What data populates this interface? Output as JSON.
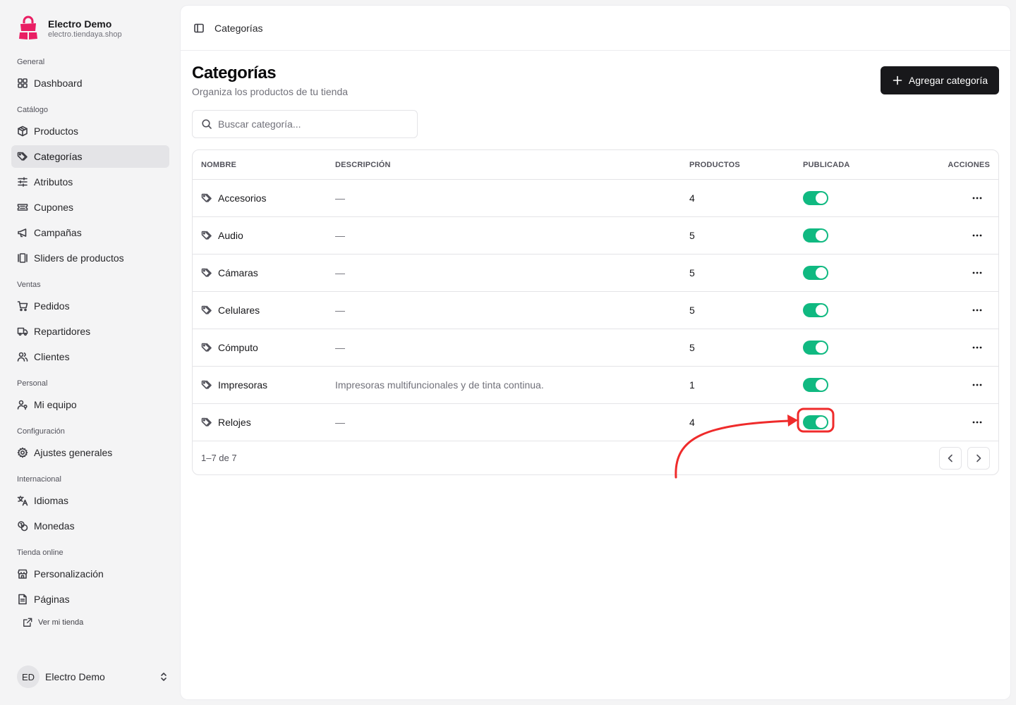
{
  "brand": {
    "name": "Electro Demo",
    "url": "electro.tiendaya.shop",
    "logo_color": "#e91e63"
  },
  "sidebar": {
    "sections": [
      {
        "label": "General",
        "items": [
          {
            "label": "Dashboard",
            "icon": "grid-icon"
          }
        ]
      },
      {
        "label": "Catálogo",
        "items": [
          {
            "label": "Productos",
            "icon": "box-icon"
          },
          {
            "label": "Categorías",
            "icon": "tag-icon",
            "active": true
          },
          {
            "label": "Atributos",
            "icon": "sliders-icon"
          },
          {
            "label": "Cupones",
            "icon": "ticket-icon"
          },
          {
            "label": "Campañas",
            "icon": "megaphone-icon"
          },
          {
            "label": "Sliders de productos",
            "icon": "gallery-icon"
          }
        ]
      },
      {
        "label": "Ventas",
        "items": [
          {
            "label": "Pedidos",
            "icon": "cart-icon"
          },
          {
            "label": "Repartidores",
            "icon": "truck-icon"
          },
          {
            "label": "Clientes",
            "icon": "users-icon"
          }
        ]
      },
      {
        "label": "Personal",
        "items": [
          {
            "label": "Mi equipo",
            "icon": "user-key-icon"
          }
        ]
      },
      {
        "label": "Configuración",
        "items": [
          {
            "label": "Ajustes generales",
            "icon": "gear-icon"
          }
        ]
      },
      {
        "label": "Internacional",
        "items": [
          {
            "label": "Idiomas",
            "icon": "translate-icon"
          },
          {
            "label": "Monedas",
            "icon": "coins-icon"
          }
        ]
      },
      {
        "label": "Tienda online",
        "items": [
          {
            "label": "Personalización",
            "icon": "store-icon"
          },
          {
            "label": "Páginas",
            "icon": "file-icon"
          }
        ]
      }
    ],
    "external_link": "Ver mi tienda",
    "user": {
      "initials": "ED",
      "name": "Electro Demo"
    }
  },
  "topbar": {
    "breadcrumb": "Categorías"
  },
  "page": {
    "title": "Categorías",
    "subtitle": "Organiza los productos de tu tienda",
    "add_button": "Agregar categoría",
    "search_placeholder": "Buscar categoría..."
  },
  "table": {
    "columns": {
      "name": "NOMBRE",
      "description": "DESCRIPCIÓN",
      "products": "PRODUCTOS",
      "published": "PUBLICADA",
      "actions": "ACCIONES"
    },
    "rows": [
      {
        "name": "Accesorios",
        "description": "—",
        "products": "4",
        "published": true
      },
      {
        "name": "Audio",
        "description": "—",
        "products": "5",
        "published": true
      },
      {
        "name": "Cámaras",
        "description": "—",
        "products": "5",
        "published": true
      },
      {
        "name": "Celulares",
        "description": "—",
        "products": "5",
        "published": true
      },
      {
        "name": "Cómputo",
        "description": "—",
        "products": "5",
        "published": true
      },
      {
        "name": "Impresoras",
        "description": "Impresoras multifuncionales y de tinta continua.",
        "products": "1",
        "published": true
      },
      {
        "name": "Relojes",
        "description": "—",
        "products": "4",
        "published": true
      }
    ],
    "range_text": "1–7 de 7"
  },
  "colors": {
    "toggle_on": "#10b981",
    "primary_button": "#18181b",
    "annotation": "#ef2b2b"
  }
}
